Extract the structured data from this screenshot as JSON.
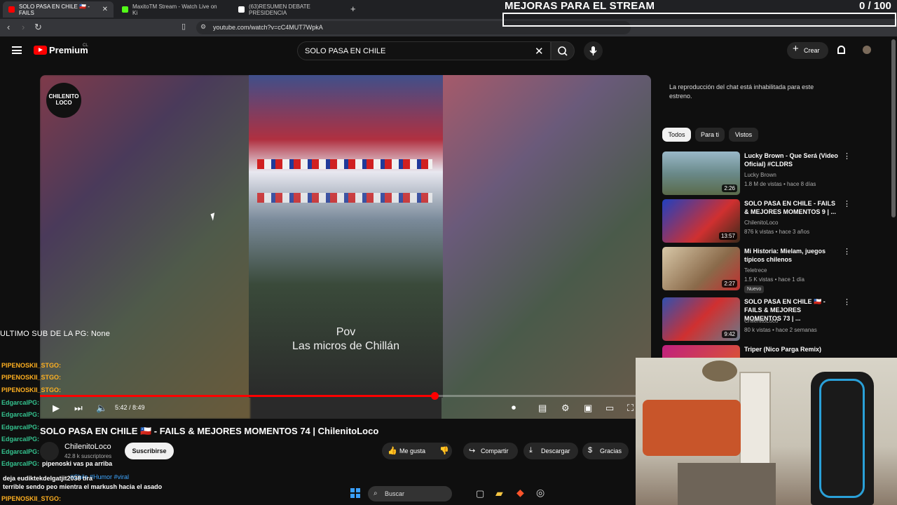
{
  "browser": {
    "tabs": [
      {
        "label": "SOLO PASA EN CHILE 🇨🇱 - FAILS",
        "color": "#ff0000",
        "active": true
      },
      {
        "label": "MaxitoTM Stream - Watch Live on Ki",
        "color": "#53fc18",
        "active": false
      },
      {
        "label": "(63)RESUMEN DEBATE PRESIDENCIA",
        "color": "#ffffff",
        "active": false
      }
    ],
    "new_tab": "+",
    "url": "youtube.com/watch?v=cC4MUT7WpkA"
  },
  "overlay": {
    "title": "MEJORAS PARA EL STREAM",
    "count": "0 / 100",
    "ultimo_sub": "ULTIMO SUB DE LA PG: None"
  },
  "header": {
    "logo": "Premium",
    "region": "CL",
    "search_value": "SOLO PASA EN CHILE",
    "create": "Crear"
  },
  "video": {
    "watermark": "CHILENITO LOCO",
    "caption_line1": "Pov",
    "caption_line2": "Las micros de Chillán",
    "time": "5:42 / 8:49",
    "progress": 0.646,
    "title": "SOLO PASA EN CHILE 🇨🇱 - FAILS & MEJORES MOMENTOS 74 | ChilenitoLoco",
    "channel": "ChilenitoLoco",
    "subs": "42.8 k suscriptores",
    "subscribe": "Suscribirse",
    "like": "Me gusta",
    "share": "Compartir",
    "download": "Descargar",
    "thanks": "Gracias",
    "description": "#Chile #Humor #viral"
  },
  "chat": {
    "lines": [
      {
        "user": "PIPENOSKII_STGO:",
        "msg": "",
        "color": "orange"
      },
      {
        "user": "PIPENOSKII_STGO:",
        "msg": "",
        "color": "orange"
      },
      {
        "user": "PIPENOSKII_STGO:",
        "msg": "",
        "color": "orange"
      },
      {
        "user": "EdgarcalPG:",
        "msg": "",
        "color": "green"
      },
      {
        "user": "EdgarcalPG:",
        "msg": "",
        "color": "green"
      },
      {
        "user": "EdgarcalPG:",
        "msg": "",
        "color": "green"
      },
      {
        "user": "EdgarcalPG:",
        "msg": "",
        "color": "green"
      },
      {
        "user": "EdgarcalPG:",
        "msg": "",
        "color": "green"
      },
      {
        "user": "EdgarcalPG:",
        "msg": "pipenoski vas pa arriba",
        "color": "green"
      }
    ],
    "overlap_text": "deja eudiktekdelgatjit2038 tira",
    "plain": "terrible sendo peo mientra el markush hacia el asado",
    "last_user": "PIPENOSKII_STGO:"
  },
  "sidebar": {
    "chat_disabled": "La reproducción del chat está inhabilitada para este estreno.",
    "chips": [
      "Todos",
      "Para ti",
      "Vistos"
    ],
    "recs": [
      {
        "title": "Lucky Brown - Que Será (Video Oficial) #CLDRS",
        "channel": "Lucky Brown",
        "meta": "1.8 M de vistas • hace 8 días",
        "duration": "2:26",
        "badge": ""
      },
      {
        "title": "SOLO PASA EN CHILE - FAILS & MEJORES MOMENTOS 9 | ...",
        "channel": "ChilenitoLoco",
        "meta": "876 k vistas • hace 3 años",
        "duration": "13:57",
        "badge": ""
      },
      {
        "title": "Mi Historia: Mielam, juegos típicos chilenos",
        "channel": "Teletrece",
        "meta": "1.5 K vistas • hace 1 día",
        "duration": "2:27",
        "badge": "Nuevo"
      },
      {
        "title": "SOLO PASA EN CHILE 🇨🇱 - FAILS & MEJORES MOMENTOS 73 | ...",
        "channel": "ChilenitoLoco",
        "meta": "80 k vistas • hace 2 semanas",
        "duration": "9:42",
        "badge": ""
      },
      {
        "title": "Triper (Nico Parga Remix)",
        "channel": "",
        "meta": "",
        "duration": "",
        "badge": ""
      }
    ]
  },
  "taskbar": {
    "search": "Buscar"
  }
}
